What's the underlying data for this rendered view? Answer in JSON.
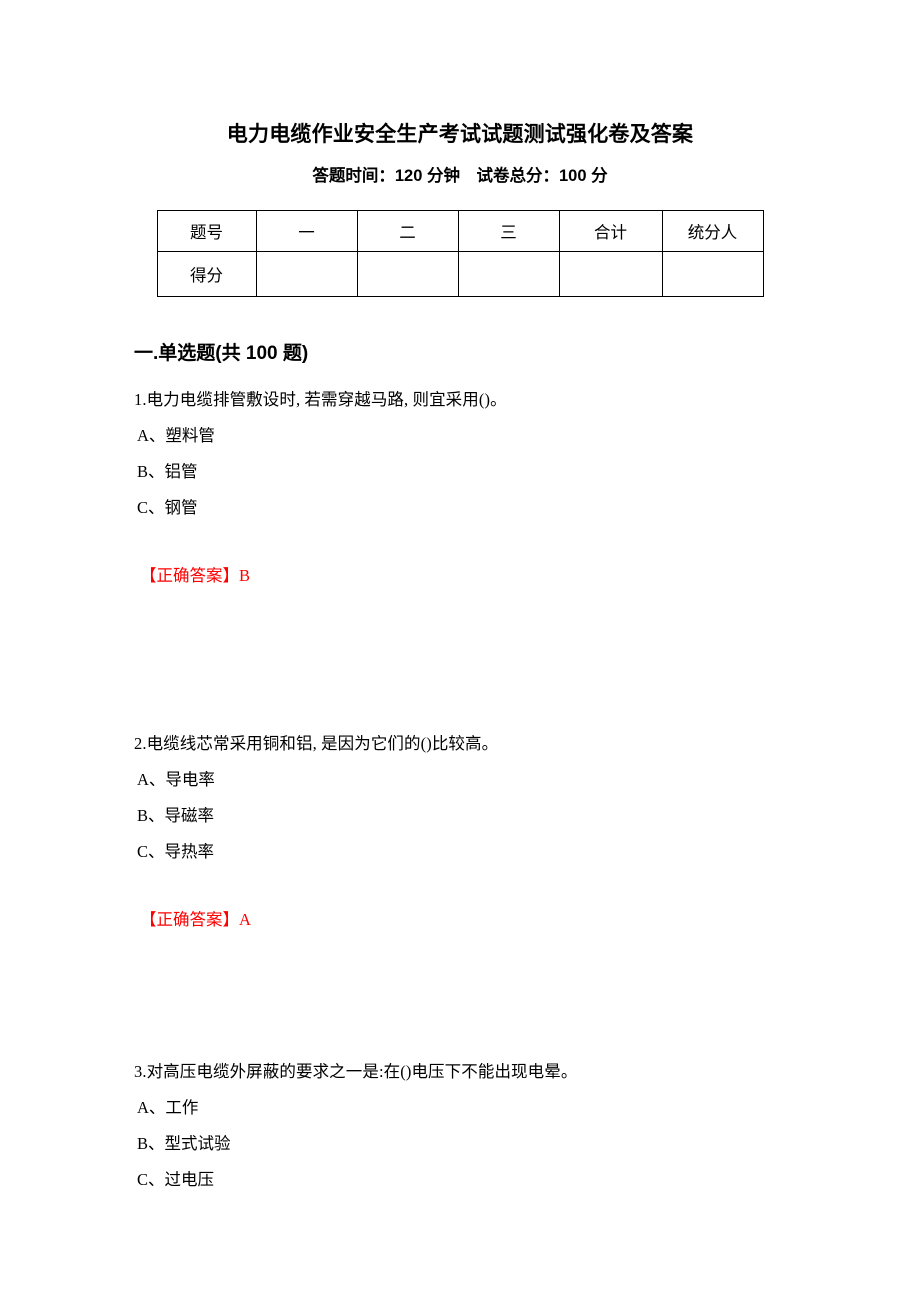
{
  "document": {
    "title": "电力电缆作业安全生产考试试题测试强化卷及答案",
    "subtitle": "答题时间：120 分钟　试卷总分：100 分"
  },
  "score_table": {
    "headers": [
      "题号",
      "一",
      "二",
      "三",
      "合计",
      "统分人"
    ],
    "rows": [
      {
        "label": "得分",
        "cells": [
          "",
          "",
          "",
          "",
          ""
        ]
      }
    ]
  },
  "section": {
    "heading": "一.单选题(共 100 题)"
  },
  "questions": [
    {
      "number": "1.",
      "stem": "1.电力电缆排管敷设时, 若需穿越马路, 则宜采用()。",
      "options": [
        "A、塑料管",
        "B、铝管",
        "C、钢管"
      ],
      "answer_label": "【正确答案】",
      "answer_value": "B",
      "answer_full": "【正确答案】B"
    },
    {
      "number": "2.",
      "stem": "2.电缆线芯常采用铜和铝, 是因为它们的()比较高。",
      "options": [
        "A、导电率",
        "B、导磁率",
        "C、导热率"
      ],
      "answer_label": "【正确答案】",
      "answer_value": "A",
      "answer_full": "【正确答案】A"
    },
    {
      "number": "3.",
      "stem": "3.对高压电缆外屏蔽的要求之一是:在()电压下不能出现电晕。",
      "options": [
        "A、工作",
        "B、型式试验",
        "C、过电压"
      ],
      "answer_label": "",
      "answer_value": "",
      "answer_full": ""
    }
  ],
  "colors": {
    "answer_red": "#ff0000",
    "text_black": "#000000",
    "table_border": "#000000",
    "page_background": "#ffffff"
  }
}
